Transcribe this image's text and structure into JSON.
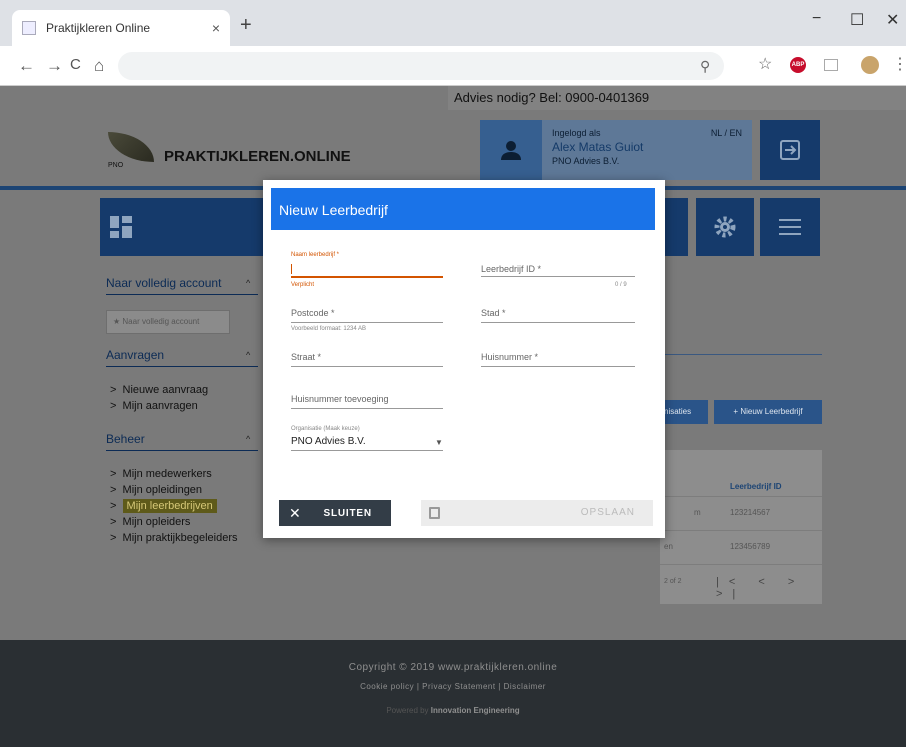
{
  "browser": {
    "tab_title": "Praktijkleren Online",
    "tab_close": "×",
    "new_tab": "+",
    "minimize": "−",
    "maximize": "☐",
    "close": "✕",
    "back": "←",
    "forward": "→",
    "reload": "C",
    "home": "⌂",
    "zoom_icon": "⚲",
    "star_icon": "☆",
    "abp_label": "ABP",
    "menu_icon": "⋮"
  },
  "header": {
    "advice": "Advies nodig? Bel: 0900-0401369",
    "logo_small": "PNO",
    "logo_text": "PRAKTIJKLEREN.ONLINE",
    "logged_in_label": "Ingelogd als",
    "user_name": "Alex Matas Guiot",
    "user_org": "PNO Advies B.V.",
    "lang": "NL / EN"
  },
  "sidebar": {
    "account_head": "Naar volledig account",
    "account_button": "★  Naar volledig account",
    "requests_head": "Aanvragen",
    "requests_items": [
      "Nieuwe aanvraag",
      "Mijn aanvragen"
    ],
    "manage_head": "Beheer",
    "manage_items": [
      "Mijn medewerkers",
      "Mijn opleidingen",
      "Mijn leerbedrijven",
      "Mijn opleiders",
      "Mijn praktijkbegeleiders"
    ]
  },
  "right_panel": {
    "btn_organisations": "nisaties",
    "btn_new": "+  Nieuw Leerbedrijf",
    "col_id": "Leerbedrijf ID",
    "rows": [
      {
        "partial": "m",
        "id": "123214567"
      },
      {
        "partial": "en",
        "id": "123456789"
      }
    ],
    "page_info": "2 of 2",
    "pager": "|<  <  >  >|"
  },
  "modal": {
    "title": "Nieuw Leerbedrijf",
    "fields": {
      "name_label": "Naam leerbedrijf *",
      "name_help": "Verplicht",
      "id_label": "Leerbedrijf ID *",
      "id_counter": "0 / 9",
      "postcode_label": "Postcode *",
      "postcode_help": "Voorbeeld formaat: 1234 AB",
      "city_label": "Stad *",
      "street_label": "Straat *",
      "housenr_label": "Huisnummer *",
      "addition_label": "Huisnummer toevoeging",
      "org_label": "Organisatie (Maak keuze)",
      "org_value": "PNO Advies B.V."
    },
    "close_label": "SLUITEN",
    "save_label": "OPSLAAN"
  },
  "footer": {
    "copyright": "Copyright © 2019 www.praktijkleren.online",
    "links": "Cookie policy  |  Privacy Statement  |  Disclaimer",
    "powered_prefix": "Powered by ",
    "powered_name": "Innovation Engineering"
  }
}
